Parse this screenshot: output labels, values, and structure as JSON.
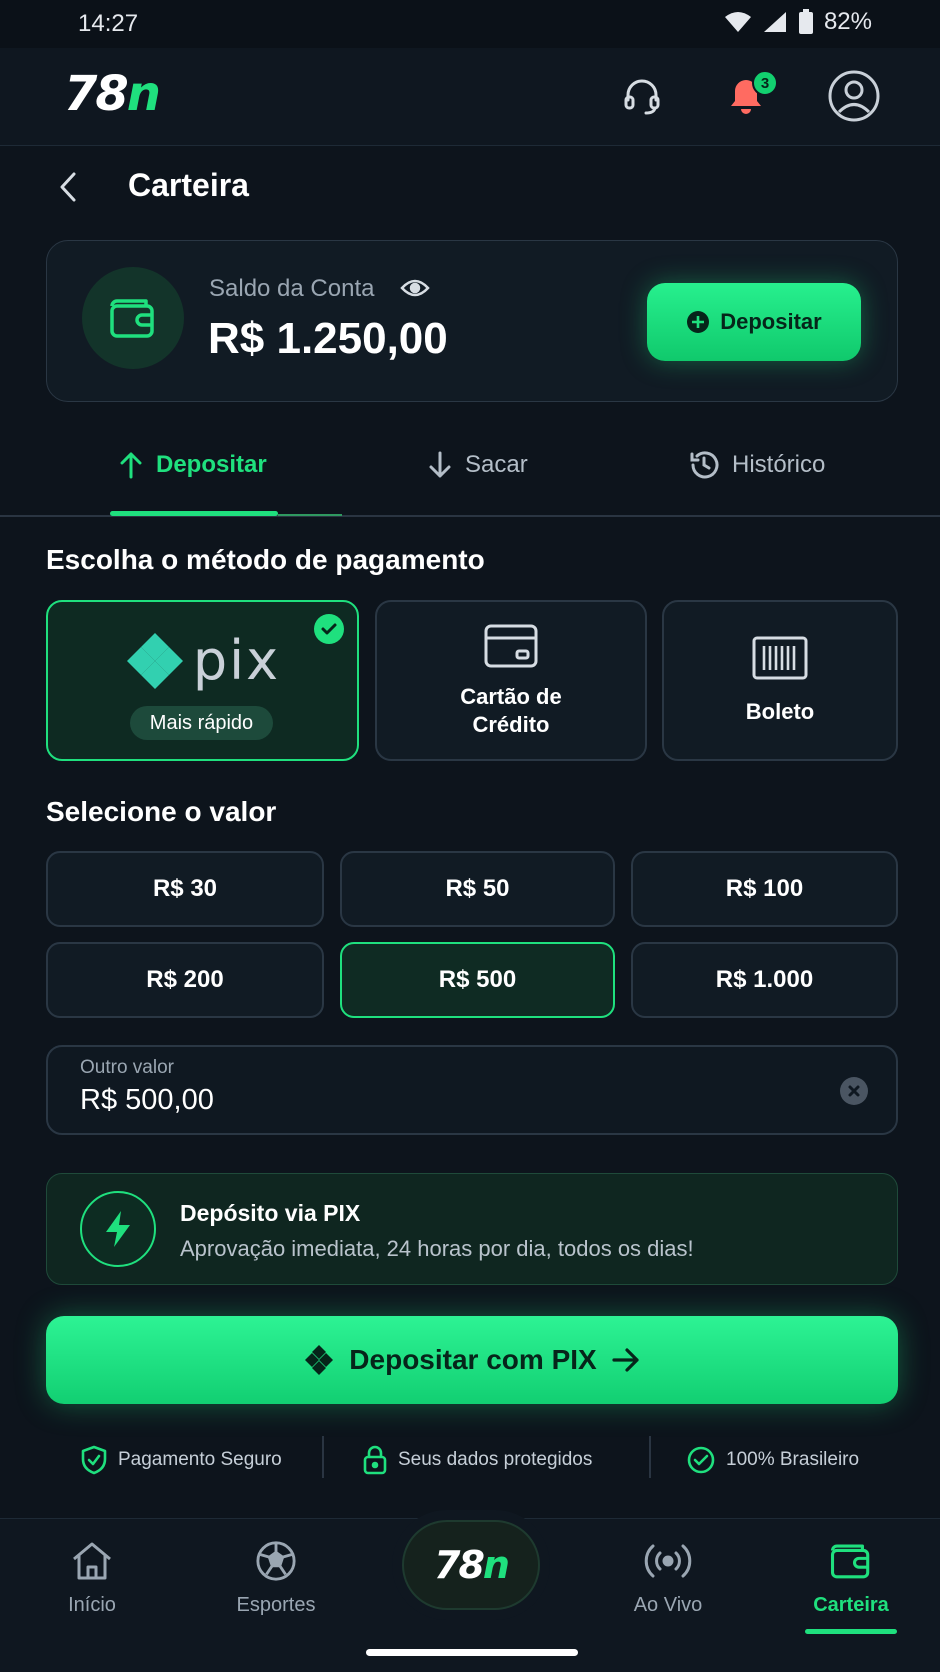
{
  "status": {
    "time": "14:27",
    "battery": "82%"
  },
  "header": {
    "logo_number": "78",
    "logo_letter": "n",
    "notification_count": "3"
  },
  "page": {
    "title": "Carteira"
  },
  "balance": {
    "label": "Saldo da Conta",
    "value": "R$ 1.250,00",
    "deposit_label": "Depositar"
  },
  "tabs": [
    {
      "label": "Depositar",
      "active": true
    },
    {
      "label": "Sacar",
      "active": false
    },
    {
      "label": "Histórico",
      "active": false
    }
  ],
  "payment": {
    "title": "Escolha o método de pagamento",
    "pix_wordmark": "pix",
    "pix_tag": "Mais rápido",
    "card_line1": "Cartão de",
    "card_line2": "Crédito",
    "boleto": "Boleto"
  },
  "amounts": {
    "title": "Selecione o valor",
    "options": [
      "R$ 30",
      "R$ 50",
      "R$ 100",
      "R$ 200",
      "R$ 500",
      "R$ 1.000"
    ],
    "selected": "R$ 500",
    "other_label": "Outro valor",
    "other_value": "R$ 500,00"
  },
  "info": {
    "title": "Depósito via PIX",
    "subtitle": "Aprovação imediata, 24 horas por dia, todos os dias!"
  },
  "cta": {
    "label": "Depositar com PIX"
  },
  "trust": [
    "Pagamento Seguro",
    "Seus dados protegidos",
    "100% Brasileiro"
  ],
  "nav": [
    {
      "label": "Início"
    },
    {
      "label": "Esportes"
    },
    {
      "label": "Ao Vivo"
    },
    {
      "label": "Carteira",
      "active": true
    }
  ],
  "colors": {
    "accent": "#1fe07e",
    "background": "#0d141c",
    "card": "#111b24",
    "border": "#2a3744"
  }
}
